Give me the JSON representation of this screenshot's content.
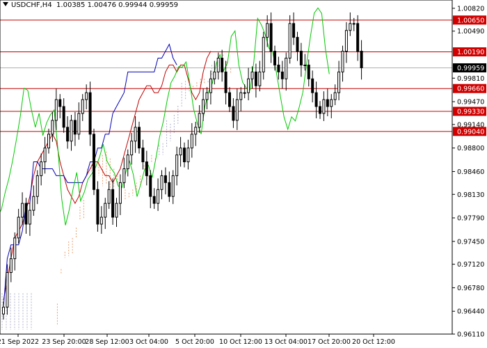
{
  "header": {
    "symbol": "USDCHF,H4",
    "open": "1.00385",
    "high": "1.00476",
    "low": "0.99944",
    "close": "0.99959"
  },
  "colors": {
    "candle": "#000000",
    "tenkan": "#c00000",
    "kijun": "#0000b4",
    "chikou": "#00c800",
    "cloud_bull": "#e8a070",
    "cloud_bear": "#b0b0d0",
    "level_line": "#c00000",
    "level_label_bg": "#d00000",
    "current_label_bg": "#000000",
    "current_line": "#b0b0b0"
  },
  "chart_data": {
    "type": "candlestick",
    "y_axis": {
      "range": [
        0.9611,
        1.0094
      ],
      "ticks": [
        "1.00820",
        "1.00490",
        "0.99810",
        "0.99470",
        "0.99140",
        "0.98800",
        "0.98460",
        "0.98130",
        "0.97790",
        "0.97450",
        "0.97120",
        "0.96780",
        "0.96440",
        "0.96110"
      ]
    },
    "x_axis": {
      "labels": [
        "21 Sep 2022",
        "23 Sep 20:00",
        "28 Sep 12:00",
        "3 Oct 04:00",
        "5 Oct 20:00",
        "10 Oct 12:00",
        "13 Oct 04:00",
        "17 Oct 20:00",
        "20 Oct 12:00"
      ]
    },
    "levels": [
      {
        "label": "1.00650",
        "value": 1.0065
      },
      {
        "label": "1.00190",
        "value": 1.0019
      },
      {
        "label": "0.99660",
        "value": 0.9966
      },
      {
        "label": "0.99330",
        "value": 0.9933
      },
      {
        "label": "0.99040",
        "value": 0.9904
      }
    ],
    "current_price": {
      "label": "0.99959",
      "value": 0.99959
    },
    "candles_close": [
      0.965,
      0.97,
      0.972,
      0.975,
      0.978,
      0.98,
      0.977,
      0.979,
      0.981,
      0.984,
      0.986,
      0.988,
      0.99,
      0.992,
      0.995,
      0.994,
      0.991,
      0.989,
      0.992,
      0.99,
      0.993,
      0.995,
      0.996,
      0.99,
      0.982,
      0.977,
      0.978,
      0.98,
      0.982,
      0.978,
      0.98,
      0.983,
      0.985,
      0.987,
      0.989,
      0.991,
      0.988,
      0.986,
      0.984,
      0.981,
      0.98,
      0.982,
      0.984,
      0.983,
      0.981,
      0.984,
      0.987,
      0.988,
      0.986,
      0.988,
      0.99,
      0.991,
      0.993,
      0.995,
      0.996,
      0.998,
      0.999,
      1.001,
      0.999,
      0.996,
      0.994,
      0.992,
      0.995,
      0.996,
      0.996,
      0.998,
      0.999,
      0.997,
      0.999,
      1.004,
      1.006,
      1.002,
      1.0,
      0.999,
      0.998,
      1.001,
      1.006,
      1.004,
      1.002,
      1.0,
      1.0,
      0.998,
      0.996,
      0.994,
      0.993,
      0.995,
      0.994,
      0.995,
      0.996,
      0.999,
      1.002,
      1.005,
      1.006,
      1.006,
      1.002,
      0.9996
    ],
    "tenkan": [
      0.966,
      0.969,
      0.972,
      0.975,
      0.976,
      0.977,
      0.979,
      0.981,
      0.984,
      0.986,
      0.987,
      0.988,
      0.989,
      0.99,
      0.989,
      0.986,
      0.984,
      0.982,
      0.981,
      0.98,
      0.981,
      0.983,
      0.984,
      0.985,
      0.986,
      0.986,
      0.985,
      0.984,
      0.984,
      0.983,
      0.984,
      0.985,
      0.987,
      0.989,
      0.991,
      0.993,
      0.995,
      0.996,
      0.997,
      0.997,
      0.996,
      0.996,
      0.997,
      0.999,
      1.0,
      1.0,
      0.999,
      1.0,
      1.0,
      0.998,
      0.996,
      0.995,
      0.996,
      0.999,
      1.001,
      1.002
    ],
    "kijun": [
      0.965,
      0.972,
      0.974,
      0.974,
      0.974,
      0.976,
      0.98,
      0.98,
      0.986,
      0.986,
      0.985,
      0.985,
      0.985,
      0.985,
      0.984,
      0.984,
      0.984,
      0.983,
      0.983,
      0.983,
      0.983,
      0.983,
      0.984,
      0.986,
      0.986,
      0.988,
      0.988,
      0.99,
      0.99,
      0.993,
      0.994,
      0.995,
      0.996,
      0.999,
      0.999,
      0.999,
      0.999,
      0.999,
      0.999,
      0.999,
      0.999,
      1.001,
      1.001,
      1.002,
      1.003,
      1.001,
      1.0
    ]
  }
}
